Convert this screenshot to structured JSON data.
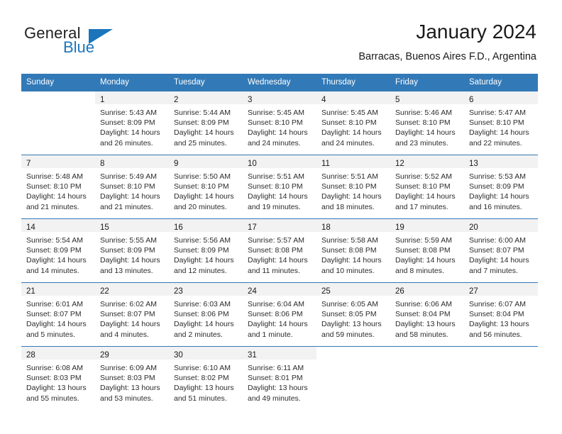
{
  "brand": {
    "word_one": "General",
    "word_two": "Blue",
    "accent_color": "#1b75bb",
    "logo_icon": "triangle-icon"
  },
  "header": {
    "title": "January 2024",
    "subtitle": "Barracas, Buenos Aires F.D., Argentina"
  },
  "calendar": {
    "header_color": "#3279b7",
    "daynum_band_color": "#f2f2f2",
    "weekday_headers": [
      "Sunday",
      "Monday",
      "Tuesday",
      "Wednesday",
      "Thursday",
      "Friday",
      "Saturday"
    ],
    "weeks": [
      [
        {
          "day": "",
          "sunrise": "",
          "sunset": "",
          "daylight_line1": "",
          "daylight_line2": ""
        },
        {
          "day": "1",
          "sunrise": "Sunrise: 5:43 AM",
          "sunset": "Sunset: 8:09 PM",
          "daylight_line1": "Daylight: 14 hours",
          "daylight_line2": "and 26 minutes."
        },
        {
          "day": "2",
          "sunrise": "Sunrise: 5:44 AM",
          "sunset": "Sunset: 8:09 PM",
          "daylight_line1": "Daylight: 14 hours",
          "daylight_line2": "and 25 minutes."
        },
        {
          "day": "3",
          "sunrise": "Sunrise: 5:45 AM",
          "sunset": "Sunset: 8:10 PM",
          "daylight_line1": "Daylight: 14 hours",
          "daylight_line2": "and 24 minutes."
        },
        {
          "day": "4",
          "sunrise": "Sunrise: 5:45 AM",
          "sunset": "Sunset: 8:10 PM",
          "daylight_line1": "Daylight: 14 hours",
          "daylight_line2": "and 24 minutes."
        },
        {
          "day": "5",
          "sunrise": "Sunrise: 5:46 AM",
          "sunset": "Sunset: 8:10 PM",
          "daylight_line1": "Daylight: 14 hours",
          "daylight_line2": "and 23 minutes."
        },
        {
          "day": "6",
          "sunrise": "Sunrise: 5:47 AM",
          "sunset": "Sunset: 8:10 PM",
          "daylight_line1": "Daylight: 14 hours",
          "daylight_line2": "and 22 minutes."
        }
      ],
      [
        {
          "day": "7",
          "sunrise": "Sunrise: 5:48 AM",
          "sunset": "Sunset: 8:10 PM",
          "daylight_line1": "Daylight: 14 hours",
          "daylight_line2": "and 21 minutes."
        },
        {
          "day": "8",
          "sunrise": "Sunrise: 5:49 AM",
          "sunset": "Sunset: 8:10 PM",
          "daylight_line1": "Daylight: 14 hours",
          "daylight_line2": "and 21 minutes."
        },
        {
          "day": "9",
          "sunrise": "Sunrise: 5:50 AM",
          "sunset": "Sunset: 8:10 PM",
          "daylight_line1": "Daylight: 14 hours",
          "daylight_line2": "and 20 minutes."
        },
        {
          "day": "10",
          "sunrise": "Sunrise: 5:51 AM",
          "sunset": "Sunset: 8:10 PM",
          "daylight_line1": "Daylight: 14 hours",
          "daylight_line2": "and 19 minutes."
        },
        {
          "day": "11",
          "sunrise": "Sunrise: 5:51 AM",
          "sunset": "Sunset: 8:10 PM",
          "daylight_line1": "Daylight: 14 hours",
          "daylight_line2": "and 18 minutes."
        },
        {
          "day": "12",
          "sunrise": "Sunrise: 5:52 AM",
          "sunset": "Sunset: 8:10 PM",
          "daylight_line1": "Daylight: 14 hours",
          "daylight_line2": "and 17 minutes."
        },
        {
          "day": "13",
          "sunrise": "Sunrise: 5:53 AM",
          "sunset": "Sunset: 8:09 PM",
          "daylight_line1": "Daylight: 14 hours",
          "daylight_line2": "and 16 minutes."
        }
      ],
      [
        {
          "day": "14",
          "sunrise": "Sunrise: 5:54 AM",
          "sunset": "Sunset: 8:09 PM",
          "daylight_line1": "Daylight: 14 hours",
          "daylight_line2": "and 14 minutes."
        },
        {
          "day": "15",
          "sunrise": "Sunrise: 5:55 AM",
          "sunset": "Sunset: 8:09 PM",
          "daylight_line1": "Daylight: 14 hours",
          "daylight_line2": "and 13 minutes."
        },
        {
          "day": "16",
          "sunrise": "Sunrise: 5:56 AM",
          "sunset": "Sunset: 8:09 PM",
          "daylight_line1": "Daylight: 14 hours",
          "daylight_line2": "and 12 minutes."
        },
        {
          "day": "17",
          "sunrise": "Sunrise: 5:57 AM",
          "sunset": "Sunset: 8:08 PM",
          "daylight_line1": "Daylight: 14 hours",
          "daylight_line2": "and 11 minutes."
        },
        {
          "day": "18",
          "sunrise": "Sunrise: 5:58 AM",
          "sunset": "Sunset: 8:08 PM",
          "daylight_line1": "Daylight: 14 hours",
          "daylight_line2": "and 10 minutes."
        },
        {
          "day": "19",
          "sunrise": "Sunrise: 5:59 AM",
          "sunset": "Sunset: 8:08 PM",
          "daylight_line1": "Daylight: 14 hours",
          "daylight_line2": "and 8 minutes."
        },
        {
          "day": "20",
          "sunrise": "Sunrise: 6:00 AM",
          "sunset": "Sunset: 8:07 PM",
          "daylight_line1": "Daylight: 14 hours",
          "daylight_line2": "and 7 minutes."
        }
      ],
      [
        {
          "day": "21",
          "sunrise": "Sunrise: 6:01 AM",
          "sunset": "Sunset: 8:07 PM",
          "daylight_line1": "Daylight: 14 hours",
          "daylight_line2": "and 5 minutes."
        },
        {
          "day": "22",
          "sunrise": "Sunrise: 6:02 AM",
          "sunset": "Sunset: 8:07 PM",
          "daylight_line1": "Daylight: 14 hours",
          "daylight_line2": "and 4 minutes."
        },
        {
          "day": "23",
          "sunrise": "Sunrise: 6:03 AM",
          "sunset": "Sunset: 8:06 PM",
          "daylight_line1": "Daylight: 14 hours",
          "daylight_line2": "and 2 minutes."
        },
        {
          "day": "24",
          "sunrise": "Sunrise: 6:04 AM",
          "sunset": "Sunset: 8:06 PM",
          "daylight_line1": "Daylight: 14 hours",
          "daylight_line2": "and 1 minute."
        },
        {
          "day": "25",
          "sunrise": "Sunrise: 6:05 AM",
          "sunset": "Sunset: 8:05 PM",
          "daylight_line1": "Daylight: 13 hours",
          "daylight_line2": "and 59 minutes."
        },
        {
          "day": "26",
          "sunrise": "Sunrise: 6:06 AM",
          "sunset": "Sunset: 8:04 PM",
          "daylight_line1": "Daylight: 13 hours",
          "daylight_line2": "and 58 minutes."
        },
        {
          "day": "27",
          "sunrise": "Sunrise: 6:07 AM",
          "sunset": "Sunset: 8:04 PM",
          "daylight_line1": "Daylight: 13 hours",
          "daylight_line2": "and 56 minutes."
        }
      ],
      [
        {
          "day": "28",
          "sunrise": "Sunrise: 6:08 AM",
          "sunset": "Sunset: 8:03 PM",
          "daylight_line1": "Daylight: 13 hours",
          "daylight_line2": "and 55 minutes."
        },
        {
          "day": "29",
          "sunrise": "Sunrise: 6:09 AM",
          "sunset": "Sunset: 8:03 PM",
          "daylight_line1": "Daylight: 13 hours",
          "daylight_line2": "and 53 minutes."
        },
        {
          "day": "30",
          "sunrise": "Sunrise: 6:10 AM",
          "sunset": "Sunset: 8:02 PM",
          "daylight_line1": "Daylight: 13 hours",
          "daylight_line2": "and 51 minutes."
        },
        {
          "day": "31",
          "sunrise": "Sunrise: 6:11 AM",
          "sunset": "Sunset: 8:01 PM",
          "daylight_line1": "Daylight: 13 hours",
          "daylight_line2": "and 49 minutes."
        },
        {
          "day": "",
          "sunrise": "",
          "sunset": "",
          "daylight_line1": "",
          "daylight_line2": ""
        },
        {
          "day": "",
          "sunrise": "",
          "sunset": "",
          "daylight_line1": "",
          "daylight_line2": ""
        },
        {
          "day": "",
          "sunrise": "",
          "sunset": "",
          "daylight_line1": "",
          "daylight_line2": ""
        }
      ]
    ]
  }
}
